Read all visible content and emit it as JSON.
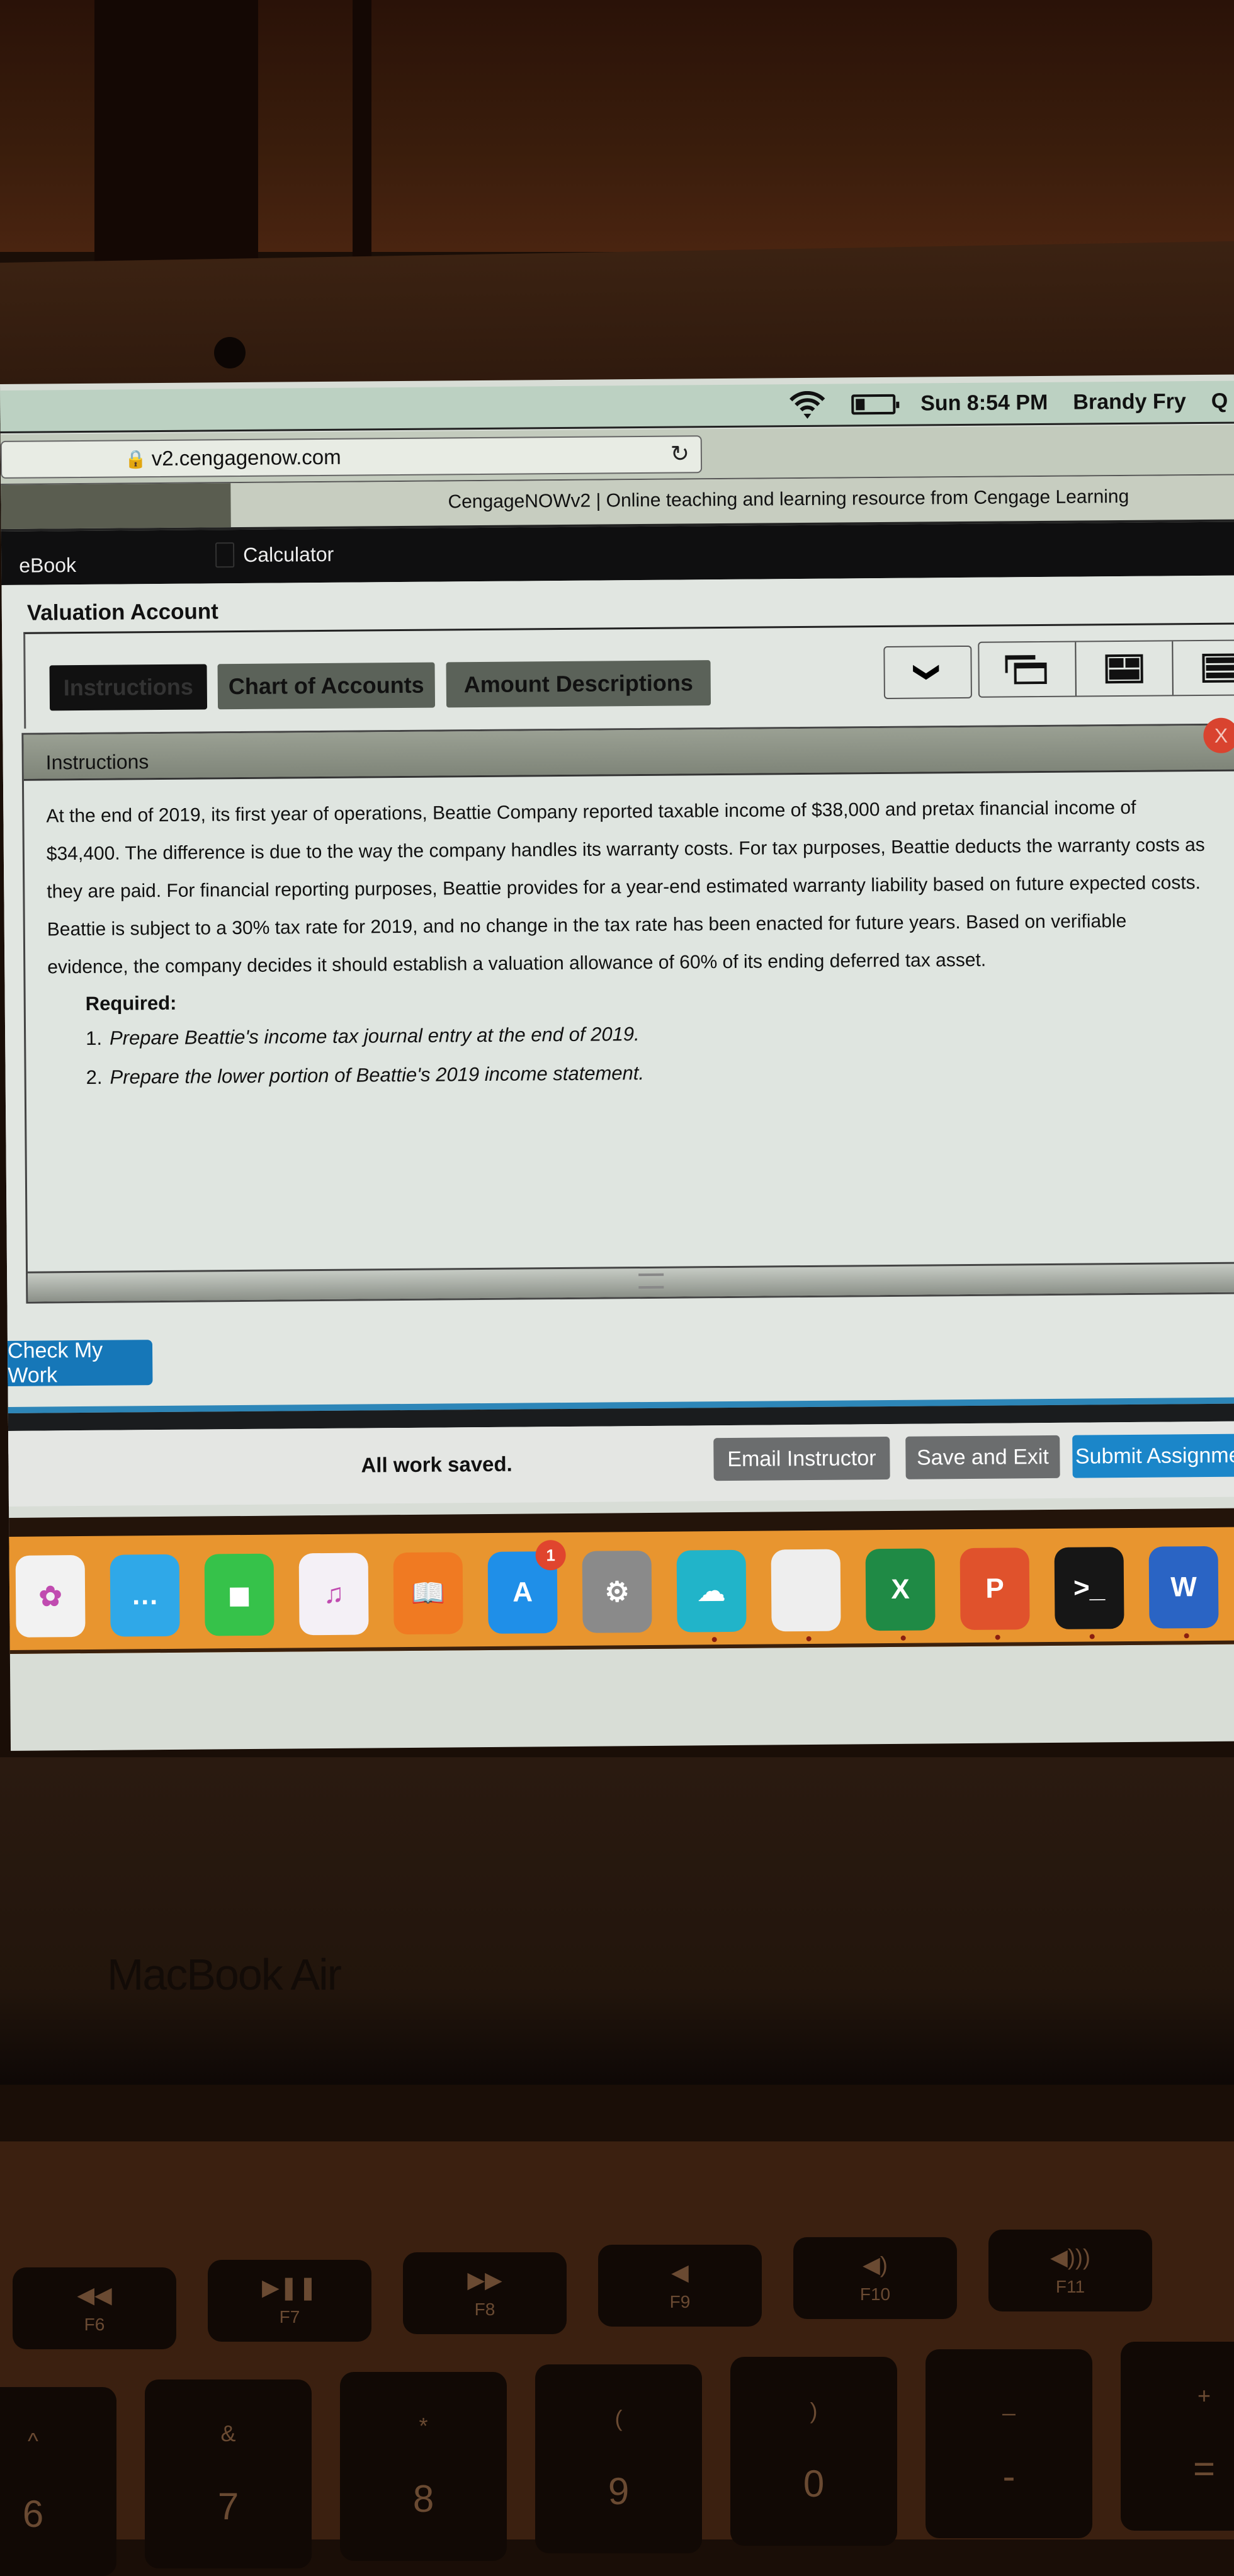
{
  "menubar": {
    "icons": [
      "wifi-icon",
      "battery-icon",
      "spotlight-search-icon"
    ],
    "datetime": "Sun 8:54 PM",
    "user": "Brandy Fry",
    "search_glyph": "Q"
  },
  "browser": {
    "lock_glyph": "🔒",
    "url": "v2.cengagenow.com",
    "reload_glyph": "↻",
    "tab_title": "CengageNOWv2 | Online teaching and learning resource from Cengage Learning"
  },
  "apptoolbar": {
    "ebook": "eBook",
    "calculator": "Calculator"
  },
  "assignment": {
    "title": "Valuation Account",
    "tabs": [
      {
        "label": "Instructions",
        "active": true
      },
      {
        "label": "Chart of Accounts",
        "active": false
      },
      {
        "label": "Amount Descriptions",
        "active": false
      }
    ],
    "dropdown_glyph": "❯",
    "view_buttons": [
      "cascade-view",
      "grid-view",
      "stacked-view"
    ]
  },
  "instructions": {
    "heading": "Instructions",
    "close_glyph": "X",
    "paragraph": "At the end of 2019, its first year of operations, Beattie Company reported taxable income of $38,000 and pretax financial income of $34,400. The difference is due to the way the company handles its warranty costs. For tax purposes, Beattie deducts the warranty costs as they are paid. For financial reporting purposes, Beattie provides for a year-end estimated warranty liability based on future expected costs. Beattie is subject to a 30% tax rate for 2019, and no change in the tax rate has been enacted for future years. Based on verifiable evidence, the company decides it should establish a valuation allowance of 60% of its ending deferred tax asset.",
    "required_label": "Required:",
    "required_items": [
      {
        "num": "1.",
        "text": "Prepare Beattie's income tax journal entry at the end of 2019."
      },
      {
        "num": "2.",
        "text": "Prepare the lower portion of Beattie's 2019 income statement."
      }
    ]
  },
  "actions": {
    "check_my_work": "Check My Work",
    "save_status": "All work saved.",
    "email_instructor": "Email Instructor",
    "save_and_exit": "Save and Exit",
    "submit_assignment": "Submit Assignment"
  },
  "dock": {
    "apps": [
      {
        "name": "Photos",
        "glyph": "✿",
        "color": "#f2f2f2"
      },
      {
        "name": "Messages",
        "glyph": "…",
        "color": "#2fa8e8"
      },
      {
        "name": "FaceTime",
        "glyph": "◼",
        "color": "#36c24a"
      },
      {
        "name": "iTunes",
        "glyph": "♫",
        "color": "#f4f0f6"
      },
      {
        "name": "Books",
        "glyph": "📖",
        "color": "#f07a22"
      },
      {
        "name": "App Store",
        "glyph": "A",
        "color": "#1f8fe8",
        "badge": "1"
      },
      {
        "name": "System Preferences",
        "glyph": "⚙",
        "color": "#8a8a8a"
      },
      {
        "name": "Cloud App",
        "glyph": "☁",
        "color": "#21b4c9"
      },
      {
        "name": "Document",
        "glyph": "",
        "color": "#eeeeee"
      },
      {
        "name": "Excel",
        "glyph": "X",
        "color": "#1f8a45"
      },
      {
        "name": "PowerPoint",
        "glyph": "P",
        "color": "#e0522c"
      },
      {
        "name": "Terminal",
        "glyph": ">_",
        "color": "#161616"
      },
      {
        "name": "Word",
        "glyph": "W",
        "color": "#2a64c4"
      }
    ]
  },
  "hardware": {
    "label": "MacBook Air",
    "fn_keys": [
      {
        "glyph": "◀◀",
        "label": "F6"
      },
      {
        "glyph": "▶❚❚",
        "label": "F7"
      },
      {
        "glyph": "▶▶",
        "label": "F8"
      },
      {
        "glyph": "◀",
        "label": "F9"
      },
      {
        "glyph": "◀)",
        "label": "F10"
      },
      {
        "glyph": "◀)))",
        "label": "F11"
      }
    ],
    "num_keys": [
      {
        "top": "^",
        "bottom": "6"
      },
      {
        "top": "&",
        "bottom": "7"
      },
      {
        "top": "*",
        "bottom": "8"
      },
      {
        "top": "(",
        "bottom": "9"
      },
      {
        "top": ")",
        "bottom": "0"
      },
      {
        "top": "_",
        "bottom": "-"
      },
      {
        "top": "+",
        "bottom": "="
      }
    ]
  }
}
